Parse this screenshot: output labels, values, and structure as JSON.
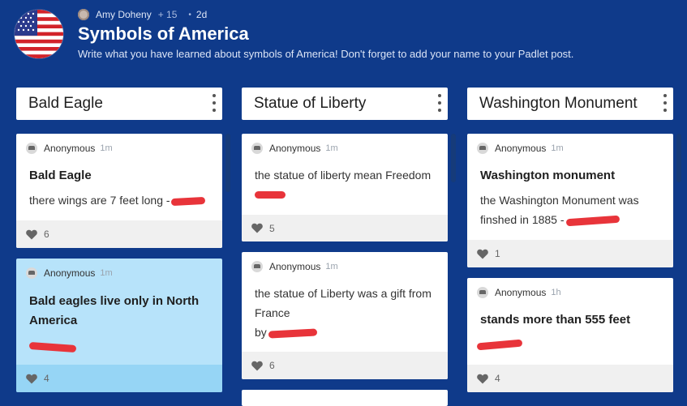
{
  "header": {
    "author": "Amy Doheny",
    "contributors": "+ 15",
    "age": "2d",
    "title": "Symbols of America",
    "description": "Write what you have learned about symbols of America! Don't forget to add your name to your Padlet post."
  },
  "columns": [
    {
      "title": "Bald Eagle",
      "posts": [
        {
          "author": "Anonymous",
          "time": "1m",
          "subject": "Bald Eagle",
          "body": "there wings are 7 feet long -",
          "likes": "6"
        },
        {
          "author": "Anonymous",
          "time": "1m",
          "subject": "Bald eagles live only in North America",
          "body": "",
          "likes": "4"
        }
      ]
    },
    {
      "title": "Statue of Liberty",
      "posts": [
        {
          "author": "Anonymous",
          "time": "1m",
          "body": "the statue of  liberty mean Freedom",
          "likes": "5"
        },
        {
          "author": "Anonymous",
          "time": "1m",
          "body": "the statue of Liberty was a gift from France",
          "body_by": "by",
          "likes": "6"
        }
      ]
    },
    {
      "title": "Washington Monument",
      "posts": [
        {
          "author": "Anonymous",
          "time": "1m",
          "subject": "Washington monument",
          "body": "the Washington Monument was finshed in 1885 -",
          "likes": "1"
        },
        {
          "author": "Anonymous",
          "time": "1h",
          "subject": "stands more than 555 feet",
          "body": "",
          "likes": "4"
        }
      ]
    }
  ],
  "colors": {
    "background": "#0f3a8a",
    "card": "#ffffff",
    "card_highlight": "#b7e3fa",
    "redaction": "#e8343a"
  },
  "icons": [
    "us-flag-icon",
    "avatar-icon",
    "anonymous-icon",
    "heart-icon",
    "more-vert-icon"
  ]
}
